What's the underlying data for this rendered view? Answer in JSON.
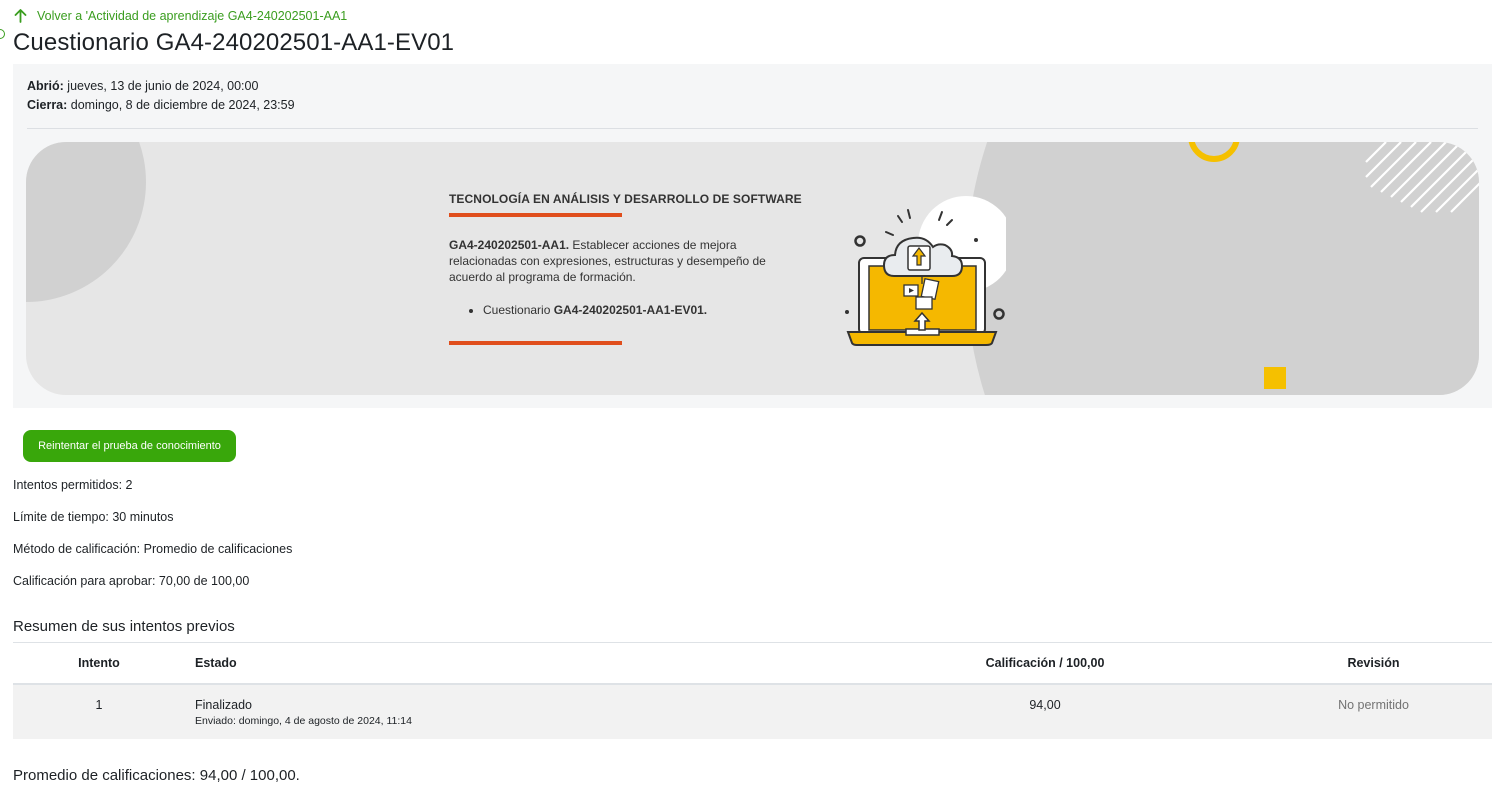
{
  "nav": {
    "back_link": "Volver a 'Actividad de aprendizaje GA4-240202501-AA1"
  },
  "page": {
    "title": "Cuestionario GA4-240202501-AA1-EV01"
  },
  "dates": {
    "opened_label": "Abrió:",
    "opened_value": "jueves, 13 de junio de 2024, 00:00",
    "closes_label": "Cierra:",
    "closes_value": "domingo, 8 de diciembre de 2024, 23:59"
  },
  "banner": {
    "heading": "TECNOLOGÍA EN ANÁLISIS Y DESARROLLO DE SOFTWARE",
    "code": "GA4-240202501-AA1.",
    "description": " Establecer acciones de mejora relacionadas con expresiones, estructuras y desempeño de acuerdo al programa de formación.",
    "bullet_prefix": "Cuestionario ",
    "bullet_code": "GA4-240202501-AA1-EV01."
  },
  "actions": {
    "retry_button": "Reintentar el prueba de conocimiento"
  },
  "info": {
    "attempts_allowed": "Intentos permitidos: 2",
    "time_limit": "Límite de tiempo: 30 minutos",
    "grading_method": "Método de calificación: Promedio de calificaciones",
    "pass_grade": "Calificación para aprobar: 70,00 de 100,00"
  },
  "summary": {
    "title": "Resumen de sus intentos previos",
    "headers": [
      "Intento",
      "Estado",
      "Calificación / 100,00",
      "Revisión"
    ],
    "rows": [
      {
        "attempt": "1",
        "state": "Finalizado",
        "submitted": "Enviado: domingo, 4 de agosto de 2024, 11:14",
        "grade": "94,00",
        "review": "No permitido"
      }
    ]
  },
  "average": "Promedio de calificaciones: 94,00 / 100,00.",
  "colors": {
    "accent_green": "#39a70b",
    "link_green": "#3a9d1f",
    "banner_orange": "#e04e1c",
    "banner_yellow": "#f5c000"
  },
  "icons": [
    "arrow-up-icon",
    "cloud-upload-icon",
    "laptop-icon"
  ]
}
